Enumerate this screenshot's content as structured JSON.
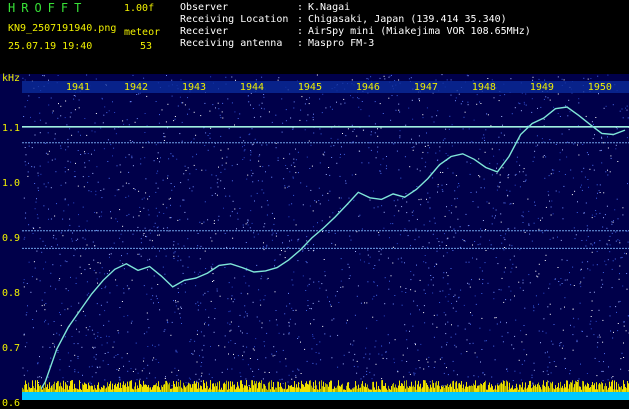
{
  "header": {
    "app_name": "HROFFT",
    "version": "1.00f",
    "filename": "KN9_2507191940.png",
    "datetime": "25.07.19 19:40",
    "meteor_label": "meteor",
    "meteor_count": "53",
    "info": [
      {
        "label": "Observer",
        "value": "K.Nagai"
      },
      {
        "label": "Receiving Location",
        "value": "Chigasaki, Japan (139.414 35.340)"
      },
      {
        "label": "Receiver",
        "value": "AirSpy mini (Miakejima VOR 108.65MHz)"
      },
      {
        "label": "Receiving antenna",
        "value": "Maspro FM-3"
      }
    ],
    "separator": ":"
  },
  "colors": {
    "background": "#000000",
    "spectrogram_bg": "#00004a",
    "trace": "#7fe6d8",
    "accent_yellow": "#f0f000",
    "baseline_cyan": "#00c8ff"
  },
  "chart_data": {
    "type": "line",
    "yaxis_unit": "kHz",
    "yticks": [
      "1.1",
      "1.0",
      "0.9",
      "0.8",
      "0.7",
      "0.6"
    ],
    "ylim": [
      0.57,
      1.16
    ],
    "minute_labels": [
      "1941",
      "1942",
      "1943",
      "1944",
      "1945",
      "1946",
      "1947",
      "1948",
      "1949",
      "1950"
    ],
    "xlim": [
      1940.0,
      1950.4
    ],
    "horizontal_lines_khz": [
      1.104,
      1.075,
      0.915,
      0.883,
      0.625,
      0.61
    ],
    "trace": [
      [
        1940.0,
        0.59
      ],
      [
        1940.2,
        0.605
      ],
      [
        1940.4,
        0.64
      ],
      [
        1940.6,
        0.7
      ],
      [
        1940.8,
        0.74
      ],
      [
        1941.0,
        0.77
      ],
      [
        1941.2,
        0.8
      ],
      [
        1941.4,
        0.825
      ],
      [
        1941.6,
        0.845
      ],
      [
        1941.8,
        0.855
      ],
      [
        1942.0,
        0.843
      ],
      [
        1942.2,
        0.85
      ],
      [
        1942.4,
        0.833
      ],
      [
        1942.6,
        0.813
      ],
      [
        1942.8,
        0.825
      ],
      [
        1943.0,
        0.829
      ],
      [
        1943.2,
        0.838
      ],
      [
        1943.4,
        0.852
      ],
      [
        1943.6,
        0.855
      ],
      [
        1943.8,
        0.848
      ],
      [
        1944.0,
        0.84
      ],
      [
        1944.2,
        0.842
      ],
      [
        1944.4,
        0.848
      ],
      [
        1944.6,
        0.862
      ],
      [
        1944.8,
        0.88
      ],
      [
        1945.0,
        0.902
      ],
      [
        1945.2,
        0.92
      ],
      [
        1945.4,
        0.94
      ],
      [
        1945.6,
        0.962
      ],
      [
        1945.8,
        0.985
      ],
      [
        1946.0,
        0.975
      ],
      [
        1946.2,
        0.972
      ],
      [
        1946.4,
        0.982
      ],
      [
        1946.6,
        0.976
      ],
      [
        1946.8,
        0.99
      ],
      [
        1947.0,
        1.01
      ],
      [
        1947.2,
        1.035
      ],
      [
        1947.4,
        1.05
      ],
      [
        1947.6,
        1.055
      ],
      [
        1947.8,
        1.045
      ],
      [
        1948.0,
        1.03
      ],
      [
        1948.2,
        1.022
      ],
      [
        1948.4,
        1.05
      ],
      [
        1948.6,
        1.09
      ],
      [
        1948.8,
        1.11
      ],
      [
        1949.0,
        1.12
      ],
      [
        1949.2,
        1.137
      ],
      [
        1949.4,
        1.14
      ],
      [
        1949.6,
        1.125
      ],
      [
        1949.8,
        1.108
      ],
      [
        1950.0,
        1.092
      ],
      [
        1950.2,
        1.09
      ],
      [
        1950.4,
        1.098
      ]
    ]
  }
}
